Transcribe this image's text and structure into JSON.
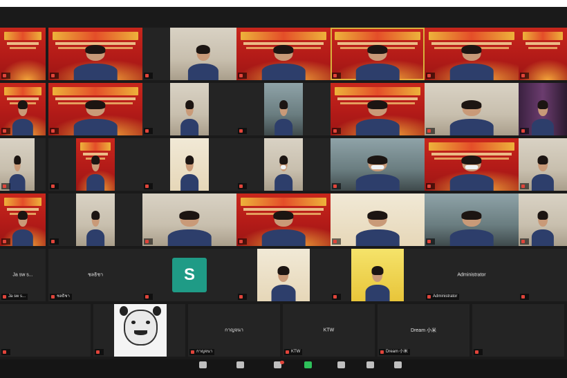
{
  "meeting": {
    "participants": [
      {
        "name": "",
        "type": "banner"
      },
      {
        "name": "",
        "type": "banner-person"
      },
      {
        "name": "",
        "type": "room-person"
      },
      {
        "name": "",
        "type": "banner-person"
      },
      {
        "name": "",
        "type": "banner-person",
        "speaking": true
      },
      {
        "name": "",
        "type": "banner-person"
      },
      {
        "name": "",
        "type": "banner"
      },
      {
        "name": "",
        "type": "banner-person"
      },
      {
        "name": "",
        "type": "banner-person"
      },
      {
        "name": "",
        "type": "room-person"
      },
      {
        "name": "",
        "type": "office-person"
      },
      {
        "name": "",
        "type": "banner-person"
      },
      {
        "name": "",
        "type": "room-person"
      },
      {
        "name": "",
        "type": "purple-person"
      },
      {
        "name": "",
        "type": "room-person"
      },
      {
        "name": "",
        "type": "banner-person"
      },
      {
        "name": "",
        "type": "warm-person"
      },
      {
        "name": "",
        "type": "room-person-mask"
      },
      {
        "name": "",
        "type": "office-person-mask"
      },
      {
        "name": "",
        "type": "banner-person-mask"
      },
      {
        "name": "",
        "type": "room-person"
      },
      {
        "name": "",
        "type": "banner-person"
      },
      {
        "name": "",
        "type": "room-person"
      },
      {
        "name": "",
        "type": "room-person"
      },
      {
        "name": "",
        "type": "banner-person"
      },
      {
        "name": "",
        "type": "warm-person"
      },
      {
        "name": "",
        "type": "office-person"
      },
      {
        "name": "",
        "type": "room-person"
      },
      {
        "name": "Ja sw s...",
        "type": "name-only"
      },
      {
        "name": "ชลธิชา",
        "type": "name-only"
      },
      {
        "name": "",
        "type": "avatar",
        "avatar_letter": "S"
      },
      {
        "name": "",
        "type": "warm-person"
      },
      {
        "name": "",
        "type": "yellow-person"
      },
      {
        "name": "Administrator",
        "type": "name-only"
      },
      {
        "name": "",
        "type": "name-only"
      },
      {
        "name": "",
        "type": "name-only"
      },
      {
        "name": "",
        "type": "meme"
      },
      {
        "name": "กาญจนา",
        "type": "name-only"
      },
      {
        "name": "KTW",
        "type": "name-only"
      },
      {
        "name": "Dream 小米",
        "type": "name-only"
      },
      {
        "name": "",
        "type": "name-only"
      }
    ]
  },
  "toolbar": {
    "items": [
      {
        "label": "",
        "icon": "security-icon",
        "tone": "default"
      },
      {
        "label": "",
        "icon": "participants-icon",
        "tone": "default"
      },
      {
        "label": "",
        "icon": "chat-icon",
        "tone": "badge"
      },
      {
        "label": "",
        "icon": "share-screen-icon",
        "tone": "share"
      },
      {
        "label": "",
        "icon": "record-icon",
        "tone": "default"
      },
      {
        "label": "",
        "icon": "reactions-icon",
        "tone": "default"
      },
      {
        "label": "",
        "icon": "apps-icon",
        "tone": "default"
      }
    ]
  },
  "colors": {
    "background": "#1a1a1a",
    "active_speaker": "#d8b23c",
    "share_green": "#2ec05a",
    "avatar_teal": "#1f9b86"
  }
}
